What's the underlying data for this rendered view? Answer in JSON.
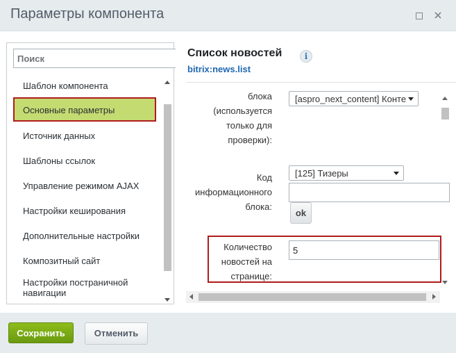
{
  "window": {
    "title": "Параметры компонента"
  },
  "sidebar": {
    "search_placeholder": "Поиск",
    "items": [
      {
        "label": "Шаблон компонента"
      },
      {
        "label": "Основные параметры"
      },
      {
        "label": "Источник данных"
      },
      {
        "label": "Шаблоны ссылок"
      },
      {
        "label": "Управление режимом AJAX"
      },
      {
        "label": "Настройки кеширования"
      },
      {
        "label": "Дополнительные настройки"
      },
      {
        "label": "Композитный сайт"
      },
      {
        "label": "Настройки постраничной навигации"
      }
    ],
    "selected_item": "Основные параметры"
  },
  "content": {
    "title": "Список новостей",
    "info_glyph": "i",
    "subtitle": "bitrix:news.list",
    "fields": {
      "iblock_type": {
        "label_line1": "блока",
        "label_line2": "(используется",
        "label_line3": "только для",
        "label_line4": "проверки):",
        "value": "[aspro_next_content] Конте"
      },
      "iblock_id": {
        "label_line1": "Код",
        "label_line2": "информационного",
        "label_line3": "блока:",
        "value": "[125] Тизеры",
        "input_value": "",
        "ok_label": "ok"
      },
      "news_count": {
        "label_line1": "Количество",
        "label_line2": "новостей на",
        "label_line3": "странице:",
        "value": "5"
      }
    }
  },
  "footer": {
    "save_label": "Сохранить",
    "cancel_label": "Отменить"
  },
  "colors": {
    "accent_green": "#7aab14",
    "highlight_red": "#b01a1a",
    "selected_item_bg": "#c4db71",
    "link_blue": "#2067b0"
  },
  "icons": [
    "maximize-icon",
    "close-icon",
    "info-icon",
    "dropdown-caret-icon"
  ]
}
